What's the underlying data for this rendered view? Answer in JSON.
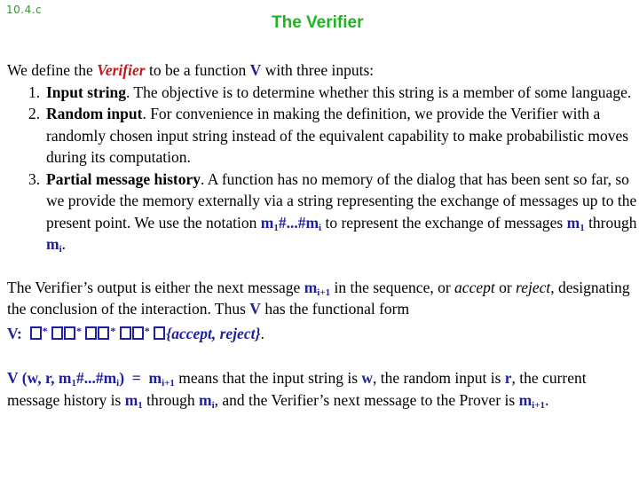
{
  "slide": {
    "number": "10.4.c",
    "title": "The Verifier"
  },
  "intro": {
    "pre": "We define the ",
    "term": "Verifier",
    "mid": " to be a function ",
    "symbol": "V",
    "post": " with three inputs:"
  },
  "inputs": [
    {
      "num": "1.",
      "name": "Input string",
      "text": ". The objective is to determine whether this string is a member of some language."
    },
    {
      "num": "2.",
      "name": "Random input",
      "text": ". For convenience in making the definition, we provide the Verifier with a randomly chosen input string instead of the equivalent capability to make probabilistic moves during its computation."
    },
    {
      "num": "3.",
      "name": "Partial message history",
      "text_a": ". A function has no memory of the dialog that has been sent so far, so we provide the memory externally via a string representing the exchange of messages up to the present point. We use the notation ",
      "notation_m": "m",
      "notation_sub1": "1",
      "notation_mid": "#...#m",
      "notation_subi": "i",
      "text_b": " to represent the exchange of messages ",
      "m1": "m",
      "m1_sub": "1",
      "through": " through ",
      "mi": "m",
      "mi_sub": "i",
      "end": "."
    }
  ],
  "output_paragraph": {
    "pre": "The Verifier’s output is either the next message ",
    "m": "m",
    "m_sub": "i+1",
    "mid": " in the sequence, or ",
    "accept": "accept",
    "or": " or ",
    "reject": "reject",
    "post": ", designating the conclusion of the interaction. Thus ",
    "V": "V",
    "post2": " has the functional form"
  },
  "functional_form": {
    "lhs": "V:",
    "star": "*",
    "result": "{accept, reject}",
    "end": "."
  },
  "meaning_paragraph": {
    "formula_V": "V (w, r, m",
    "formula_sub1": "1",
    "formula_mid": "#...#m",
    "formula_subi": "i",
    "formula_close": ")",
    "equals": " = ",
    "rhs_m": "m",
    "rhs_sub": "i+1",
    "t1": " means that the input string is ",
    "w": "w",
    "t2": ", the random input is ",
    "r": "r",
    "t3": ", the current message history is ",
    "m1": "m",
    "m1_sub": "1",
    "t4": " through ",
    "mi": "m",
    "mi_sub": "i",
    "t5": ", and the Verifier’s next message to the Prover is ",
    "mn": "m",
    "mn_sub": "i+1",
    "end": "."
  }
}
